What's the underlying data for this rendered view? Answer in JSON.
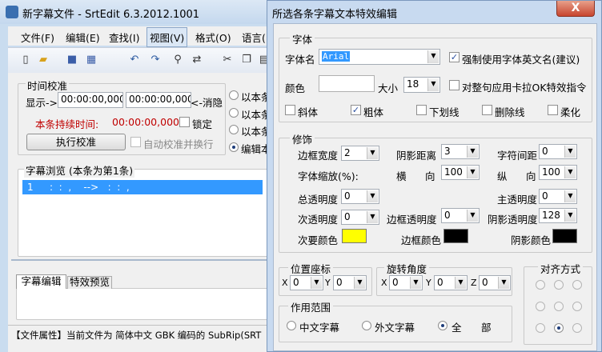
{
  "main_window": {
    "title": "新字幕文件 - SrtEdit 6.3.2012.1001",
    "menus": [
      "文件(F)",
      "编辑(E)",
      "查找(I)",
      "视图(V)",
      "格式(O)",
      "语言("
    ],
    "time_group": {
      "title": "时间校准",
      "show_label": "显示->",
      "start": "00:00:00,000",
      "end": "00:00:00,000",
      "cancel": "<-消隐",
      "duration_label": "本条持续时间:",
      "duration": "00:00:00,000",
      "lock": "锁定",
      "apply": "执行校准",
      "auto": "自动校准并换行"
    },
    "radios": [
      "以本条",
      "以本条",
      "以本条",
      "编辑本"
    ],
    "preview": {
      "title": "字幕浏览 (本条为第1条)",
      "row_index": "1",
      "row_text": ":  :  ,    -->   :  :  ,"
    },
    "tabs": [
      "字幕编辑",
      "特效预览"
    ],
    "status": "【文件属性】当前文件为 简体中文 GBK 编码的 SubRip(SRT"
  },
  "dialog": {
    "title": "所选各条字幕文本特效编辑",
    "close": "X",
    "font": {
      "title": "字体",
      "name_label": "字体名",
      "name_value": "Arial",
      "force_en": "强制使用字体英文名(建议)",
      "color_label": "颜色",
      "size_label": "大小",
      "size_value": "18",
      "karaoke": "对整句应用卡拉OK特效指令",
      "italic": "斜体",
      "bold": "粗体",
      "underline": "下划线",
      "strike": "删除线",
      "soft": "柔化"
    },
    "deco": {
      "title": "修饰",
      "border_w": "边框宽度",
      "border_w_v": "2",
      "shadow_d": "阴影距离",
      "shadow_d_v": "3",
      "char_sp": "字符间距",
      "char_sp_v": "0",
      "scale": "字体缩放(%):",
      "h_lbl": "横",
      "dir": "向",
      "h_v": "100",
      "v_lbl": "纵",
      "v_v": "100",
      "total_a": "总透明度",
      "total_a_v": "0",
      "main_a": "主透明度",
      "main_a_v": "0",
      "sec_a": "次透明度",
      "sec_a_v": "0",
      "border_a": "边框透明度",
      "border_a_v": "0",
      "shadow_a": "阴影透明度",
      "shadow_a_v": "128",
      "sec_color": "次要颜色",
      "border_color": "边框颜色",
      "shadow_color": "阴影颜色"
    },
    "pos": {
      "title": "位置座标",
      "x": "X",
      "x_v": "0",
      "y": "Y",
      "y_v": "0"
    },
    "rot": {
      "title": "旋转角度",
      "x": "X",
      "x_v": "0",
      "y": "Y",
      "y_v": "0",
      "z": "Z",
      "z_v": "0"
    },
    "align": {
      "title": "对齐方式"
    },
    "scope": {
      "title": "作用范围",
      "cn": "中文字幕",
      "foreign": "外文字幕",
      "all_a": "全",
      "all_b": "部"
    }
  },
  "colors": {
    "fill": "#ffffff",
    "secondary": "#ffff00",
    "border": "#000000",
    "shadow": "#000000"
  }
}
